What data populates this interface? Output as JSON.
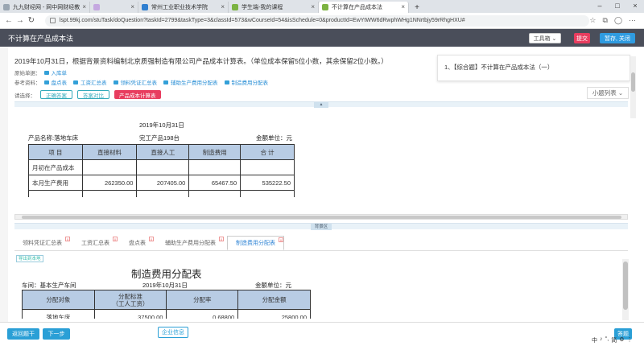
{
  "browser": {
    "tabs": [
      {
        "label": "九九财经网 - 网中网财经教",
        "color": "#9aa6b2"
      },
      {
        "label": "",
        "color": "#c5a8e0"
      },
      {
        "label": "常州工业职业技术学院",
        "color": "#2f7fd0"
      },
      {
        "label": "学生端-我的课程",
        "color": "#7cb342"
      },
      {
        "label": "不计算在产品成本法",
        "color": "#7cb342"
      }
    ],
    "url": "lspt.99kj.com/stuTask/doQuestion?taskId=2799&taskType=3&classId=573&wCourseId=54&isSchedule=0&productId=EwYtWW6dRwphWHg1NNrtbjy59rRhgHXU#"
  },
  "app": {
    "title": "不计算在产品成本法",
    "tool_btn": "工具箱 ⌄",
    "submit": "提交",
    "save_close": "暂存, 关闭"
  },
  "question": {
    "text": "2019年10月31日，根据背景资料编制北京质强制造有限公司产品成本计算表。（单位成本保留5位小数，其余保留2位小数。）",
    "original_label": "原始单据：",
    "original_doc": "入库单",
    "ref_label": "参考资料：",
    "refs": [
      "盘点表",
      "工资汇总表",
      "领料凭证汇总表",
      "辅助生产费用分配表",
      "制造费用分配表"
    ],
    "choose_label": "请选择：",
    "choices": [
      "正确答案",
      "答案对比",
      "产品成本计算表"
    ]
  },
  "panel": {
    "item": "1、【综合题】不计算在产品成本法（一）",
    "list_btn": "小题列表 ⌄"
  },
  "report1": {
    "date": "2019年10月31日",
    "product": "产品名称:落地车床",
    "finished": "完工产品198台",
    "unit": "金额单位：元",
    "headers": [
      "项  目",
      "直接材料",
      "直接人工",
      "制造费用",
      "合  计"
    ],
    "rows": [
      [
        "月初在产品成本",
        "",
        "",
        "",
        ""
      ],
      [
        "本月生产费用",
        "262350.00",
        "207405.00",
        "65467.50",
        "535222.50"
      ]
    ]
  },
  "bg_label": "背景区",
  "subtabs": [
    {
      "label": "领料凭证汇总表",
      "active": false
    },
    {
      "label": "工资汇总表",
      "active": false
    },
    {
      "label": "盘点表",
      "active": false
    },
    {
      "label": "辅助生产费用分配表",
      "active": false
    },
    {
      "label": "制造费用分配表",
      "active": true
    }
  ],
  "export_label": "导出到本地",
  "report2": {
    "title": "制造费用分配表",
    "dept": "车间：基本生产车间",
    "date": "2019年10月31日",
    "unit": "金额单位：元",
    "headers": [
      "分配对象",
      "分配标准\n（工人工资）",
      "分配率",
      "分配金额"
    ],
    "row": [
      "落地车床",
      "37500.00",
      "0.68800",
      "25800.00"
    ]
  },
  "footer": {
    "back": "返回题干",
    "next": "下一步",
    "company": "企业信息",
    "right_btn": "答题"
  },
  "tray": [
    "中",
    "♪",
    "°,",
    "简",
    "⚙",
    "⋮"
  ],
  "colors": {
    "accent": "#2a8fd6",
    "header": "#4a4e5a",
    "submit": "#e83d5f",
    "save": "#2f9be0",
    "table_head": "#b8cce4"
  }
}
